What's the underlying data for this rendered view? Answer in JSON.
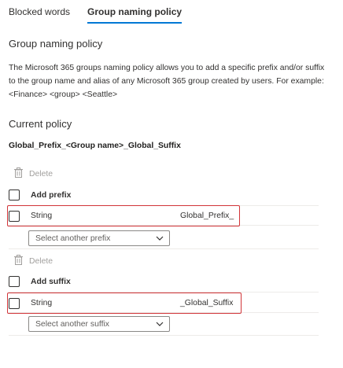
{
  "tabs": [
    {
      "label": "Blocked words",
      "active": false
    },
    {
      "label": "Group naming policy",
      "active": true
    }
  ],
  "page": {
    "title": "Group naming policy",
    "description": "The Microsoft 365 groups naming policy allows you to add a specific prefix and/or suffix to the group name and alias of any Microsoft 365 group created by users. For example: <Finance> <group> <Seattle>"
  },
  "current_policy": {
    "heading": "Current policy",
    "preview": "Global_Prefix_<Group name>_Global_Suffix"
  },
  "prefix": {
    "delete_label": "Delete",
    "add_label": "Add prefix",
    "row_type": "String",
    "row_value": "Global_Prefix_",
    "select_placeholder": "Select another prefix"
  },
  "suffix": {
    "delete_label": "Delete",
    "add_label": "Add suffix",
    "row_type": "String",
    "row_value": "_Global_Suffix",
    "select_placeholder": "Select another suffix"
  },
  "colors": {
    "accent": "#0078d4",
    "highlight": "#d13438",
    "disabled_text": "#a19f9d"
  }
}
